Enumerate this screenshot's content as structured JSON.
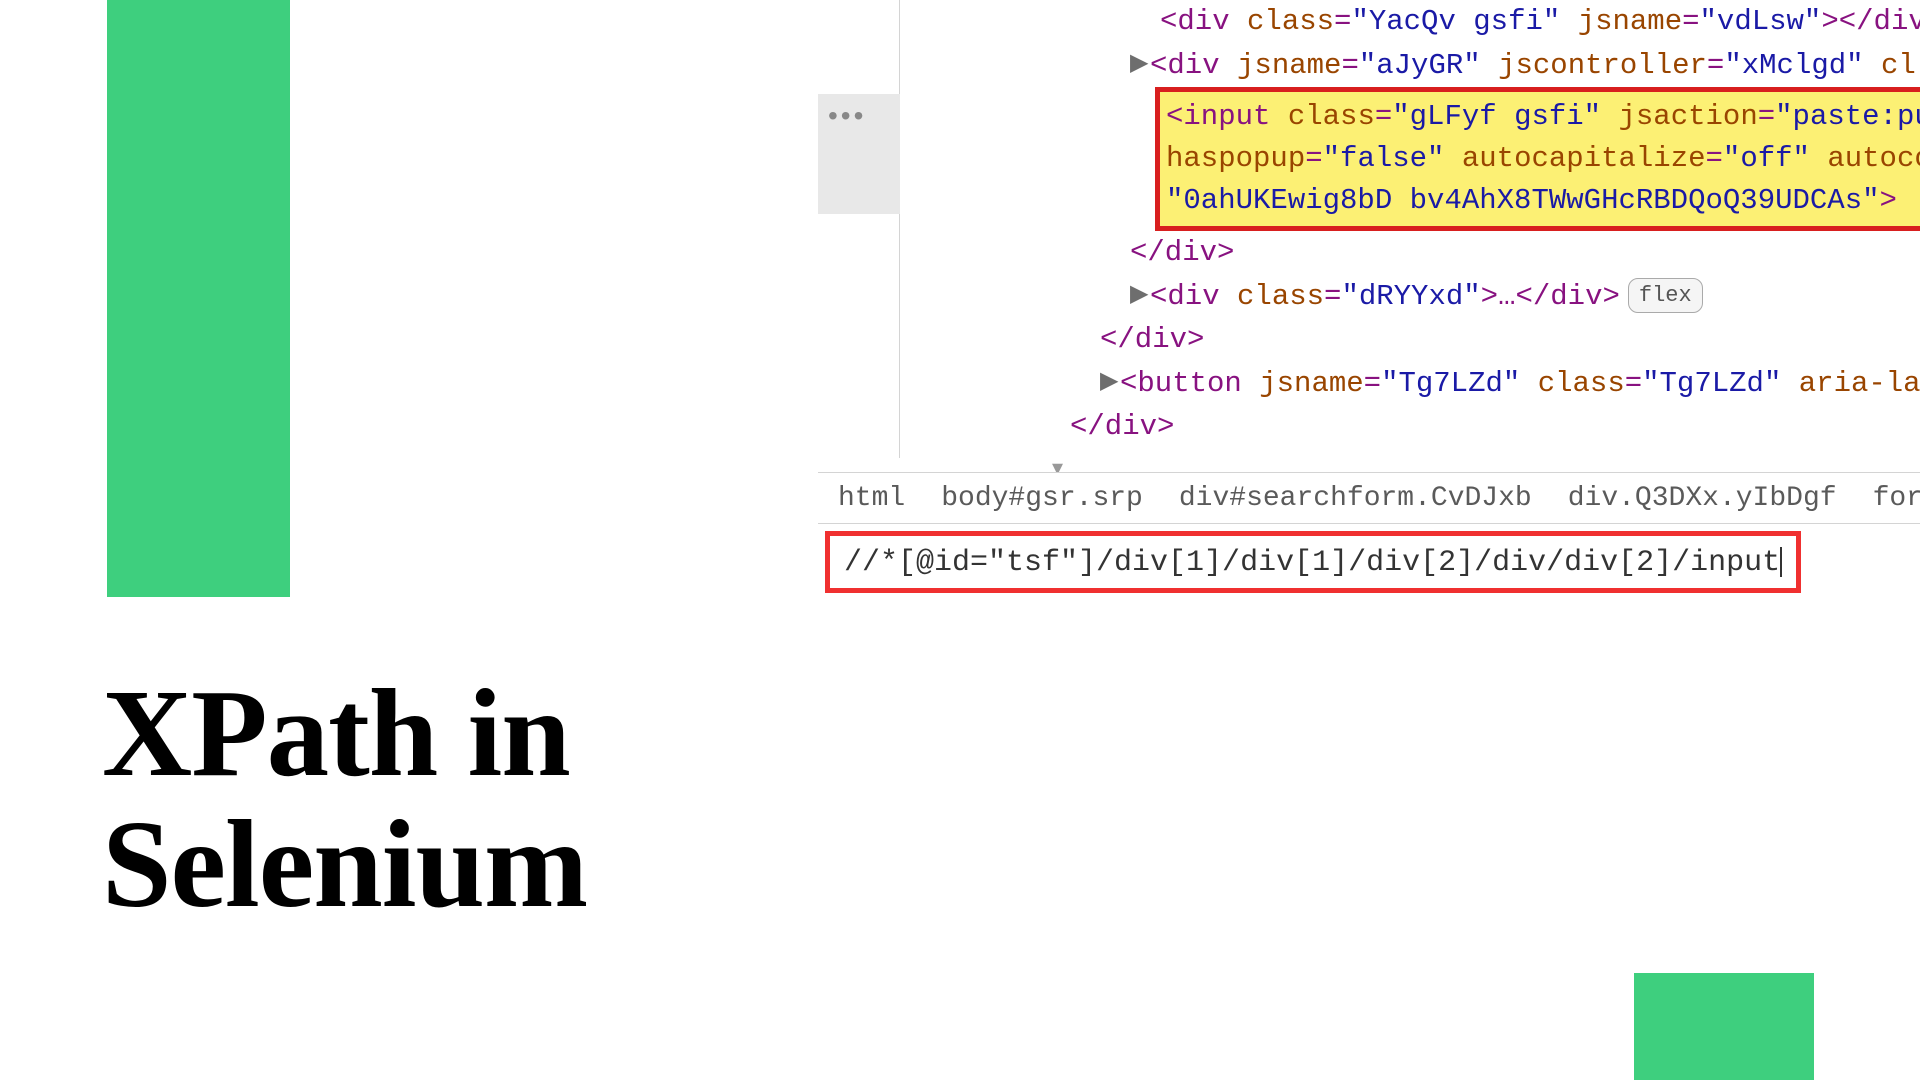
{
  "title_line1": "XPath in",
  "title_line2": "Selenium",
  "gutter_dots": "•••",
  "code": {
    "line1_pre": "<div ",
    "line1_class_k": "class",
    "line1_class_v": "\"YacQv gsfi\"",
    "line1_jsname_k": "jsname",
    "line1_jsname_v": "\"vdLsw\"",
    "line1_post": "></div",
    "line2_pre": "<div ",
    "line2_jsname_k": "jsname",
    "line2_jsname_v": "\"aJyGR\"",
    "line2_jsc_k": "jscontroller",
    "line2_jsc_v": "\"xMclgd\"",
    "line2_post": " cl",
    "highlight_l1_a": "<input ",
    "highlight_l1_class_k": "class",
    "highlight_l1_class_v": "\"gLFyf gsfi\"",
    "highlight_l1_jsa_k": "jsaction",
    "highlight_l1_jsa_v": "\"paste:pu",
    "highlight_l2_hp_k": "haspopup",
    "highlight_l2_hp_v": "\"false\"",
    "highlight_l2_ac_k": "autocapitalize",
    "highlight_l2_ac_v": "\"off\"",
    "highlight_l2_post": " autoco",
    "highlight_l3": "\"0ahUKEwig8bD  bv4AhX8TWwGHcRBDQoQ39UDCAs\"",
    "highlight_l3_post": ">",
    "closediv": "</div>",
    "line_dry_pre": "<div ",
    "line_dry_class_k": "class",
    "line_dry_class_v": "\"dRYYxd\"",
    "line_dry_post": ">…</div>",
    "flex_label": "flex",
    "line_btn_pre": "<button ",
    "line_btn_jsn_k": "jsname",
    "line_btn_jsn_v": "\"Tg7LZd\"",
    "line_btn_cls_k": "class",
    "line_btn_cls_v": "\"Tg7LZd\"",
    "line_btn_aria_k": "aria-lab"
  },
  "breadcrumb": {
    "b1": "html",
    "b2": "body#gsr.srp",
    "b3": "div#searchform.CvDJxb",
    "b4": "div.Q3DXx.yIbDgf",
    "b5": "form#tsf."
  },
  "xpath": "//*[@id=\"tsf\"]/div[1]/div[1]/div[2]/div/div[2]/input"
}
